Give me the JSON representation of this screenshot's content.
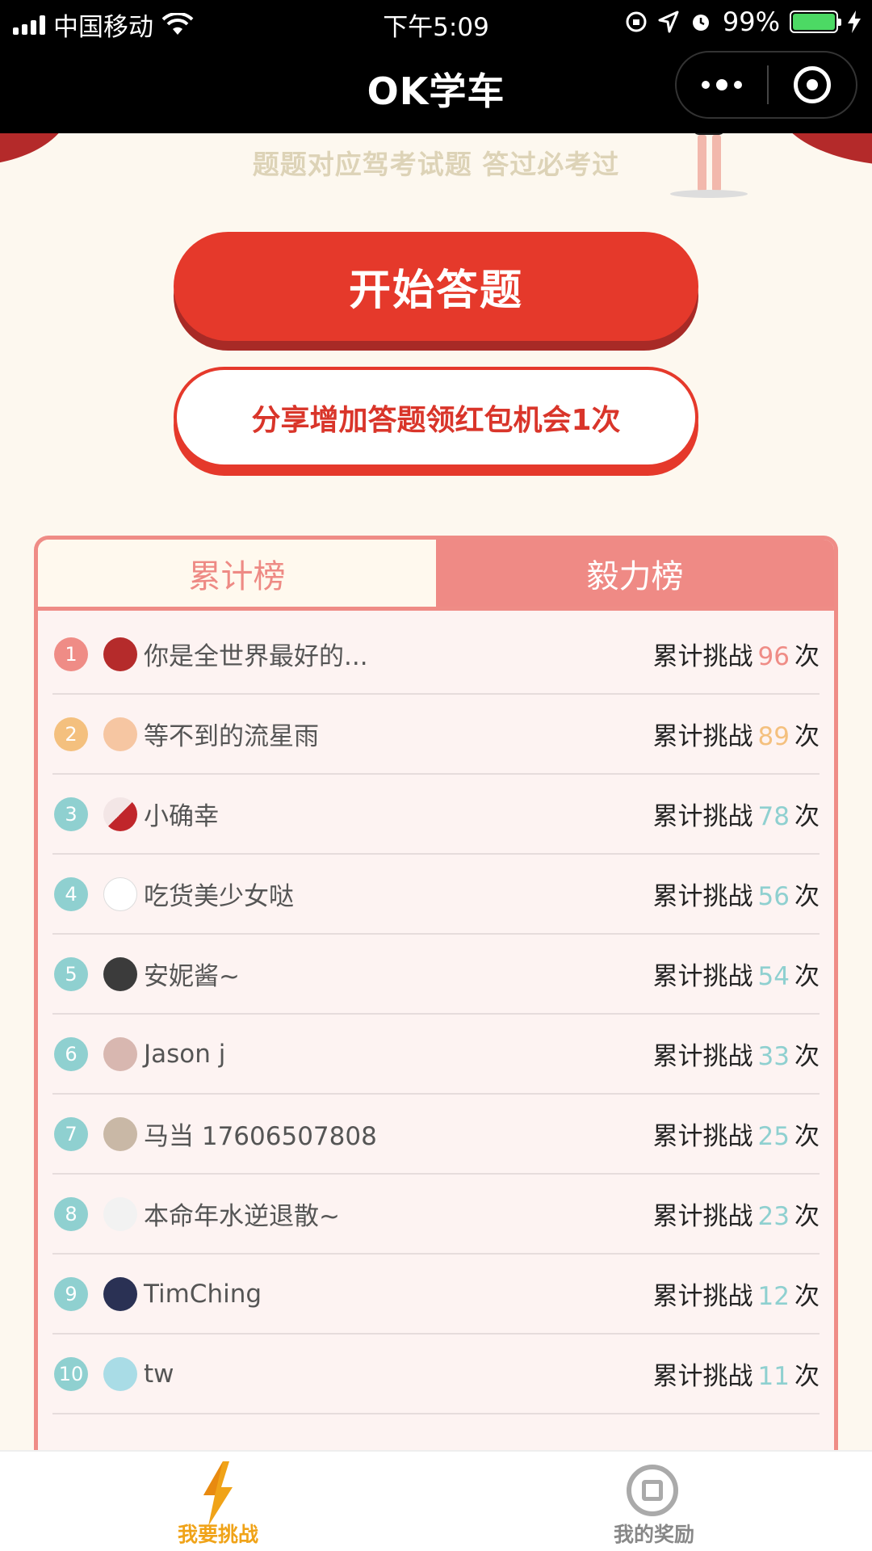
{
  "status_bar": {
    "carrier": "中国移动",
    "time": "下午5:09",
    "battery": "99%"
  },
  "nav": {
    "title": "OK学车"
  },
  "banner": {
    "slogan": "题题对应驾考试题 答过必考过"
  },
  "actions": {
    "start_label": "开始答题",
    "share_label": "分享增加答题领红包机会1次"
  },
  "leaderboard": {
    "tabs": [
      {
        "label": "累计榜",
        "active": false
      },
      {
        "label": "毅力榜",
        "active": true
      }
    ],
    "stat_prefix": "累计挑战",
    "stat_unit": "次",
    "rows": [
      {
        "rank": "1",
        "name": "你是全世界最好的...",
        "count": "96"
      },
      {
        "rank": "2",
        "name": "等不到的流星雨",
        "count": "89"
      },
      {
        "rank": "3",
        "name": "小确幸",
        "count": "78"
      },
      {
        "rank": "4",
        "name": "吃货美少女哒",
        "count": "56"
      },
      {
        "rank": "5",
        "name": "安妮酱~",
        "count": "54"
      },
      {
        "rank": "6",
        "name": "Jason j",
        "count": "33"
      },
      {
        "rank": "7",
        "name": "马当 17606507808",
        "count": "25"
      },
      {
        "rank": "8",
        "name": "本命年水逆退散~",
        "count": "23"
      },
      {
        "rank": "9",
        "name": "TimChing",
        "count": "12"
      },
      {
        "rank": "10",
        "name": "tw",
        "count": "11"
      }
    ],
    "rank_colors": {
      "first": "#ef8c86",
      "second": "#f4c07e",
      "rest": "#8fd0d0"
    },
    "count_colors": {
      "first": "#ef8c86",
      "second": "#f4c07e",
      "rest": "#8fd0d0"
    },
    "avatar_icons": [
      "avatar-red-cap",
      "avatar-pink-girl",
      "avatar-red-figure",
      "avatar-home",
      "avatar-dark-photo",
      "avatar-red-doodle",
      "avatar-man-photo",
      "avatar-runner",
      "avatar-city-night",
      "avatar-plain-blue"
    ]
  },
  "tabbar": {
    "items": [
      {
        "label": "我要挑战",
        "icon": "lightning-icon",
        "active": true
      },
      {
        "label": "我的奖励",
        "icon": "award-icon",
        "active": false
      }
    ]
  },
  "colors": {
    "primary_red": "#e5392b",
    "board_pink": "#ef8a85",
    "tab_active_text": "#f0a318"
  }
}
